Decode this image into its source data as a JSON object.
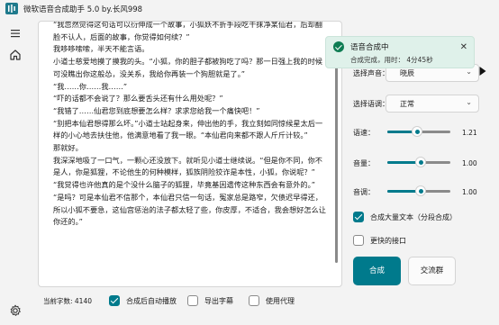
{
  "window": {
    "title": "微软语音合成助手 5.0 by.长风998"
  },
  "editor": {
    "text": "“我忽然觉得这句话可以衍伸成一个故事，小狐妖不折手段吃干抹净某仙君，后却翻脸不认人，后面的故事，你觉得如何续？”\n我哆哆嗦嗦，半天不能言语。\n小道士慈爱地摸了摸我的头。“小狐，你的胆子都被狗吃了吗？那一日强上我的时候可没瞧出你这般怂，没关系，我给你再装一个狗胆就是了。”\n“我……你……我……”\n“吓的话都不会说了？那么要舌头还有什么用处呢？”\n“我错了……仙君您到底想要怎么样？求求您给我一个痛快吧！”\n“别把本仙君想得那么坏。”小道士站起身来，伸出他的手，我立刻如同惊候星太后一样的小心地去扶住他，他满意地看了我一眼。“本仙君向来都不跟人斤斤计较。”\n那就好。\n我深深地吸了一口气，一颗心还没放下。就听见小道士继续说。“但是你不同，你不是人，你是狐狸，不论他生的何种模样，狐族阴险狡诈是本性，小狐，你说呢？”\n“我觉得也许他真的是个没什么脑子的狐狸，毕竟基因遗传这种东西会有意外的。”\n“是吗？可是本仙君不信那个，本仙君只信一句话，冤家总是路窄，欠债迟早得还，所以小狐不要急，这仙宫惩治的法子都太轻了些，你皮厚，不适合，我会想好怎么让你还的。”"
  },
  "status": {
    "word_count_label": "当前字数: 4140"
  },
  "options": {
    "auto_play": {
      "label": "合成后自动播放",
      "checked": true
    },
    "export_subtitle": {
      "label": "导出字幕",
      "checked": false
    },
    "use_proxy": {
      "label": "使用代理",
      "checked": false
    },
    "batch_text": {
      "label": "合成大量文本（分段合成）",
      "checked": true
    },
    "faster_api": {
      "label": "更快的接口",
      "checked": false
    }
  },
  "toast": {
    "title": "语音合成中",
    "message": "合成完成，用时：  4分45秒",
    "close_glyph": "✕"
  },
  "voice": {
    "label": "选择声音：",
    "value": "晓辰",
    "arrow": "⌄"
  },
  "tone": {
    "label": "选择语调：",
    "value": "正常",
    "arrow": "⌄"
  },
  "sliders": {
    "rate": {
      "label": "语速：",
      "value_text": "1.21",
      "fraction": 0.47
    },
    "pitch": {
      "label": "音量：",
      "value_text": "1.00",
      "fraction": 0.53
    },
    "volume": {
      "label": "音调：",
      "value_text": "1.00",
      "fraction": 0.53
    }
  },
  "buttons": {
    "synthesize": "合成",
    "community": "交流群"
  },
  "colors": {
    "accent": "#007a8c",
    "toast_bg": "#dff1ea",
    "success": "#0e7c53"
  },
  "icons": {
    "app": "audio-sliders-icon",
    "menu": "hamburger-icon",
    "home": "home-icon",
    "settings": "gear-icon",
    "play": "play-icon"
  }
}
